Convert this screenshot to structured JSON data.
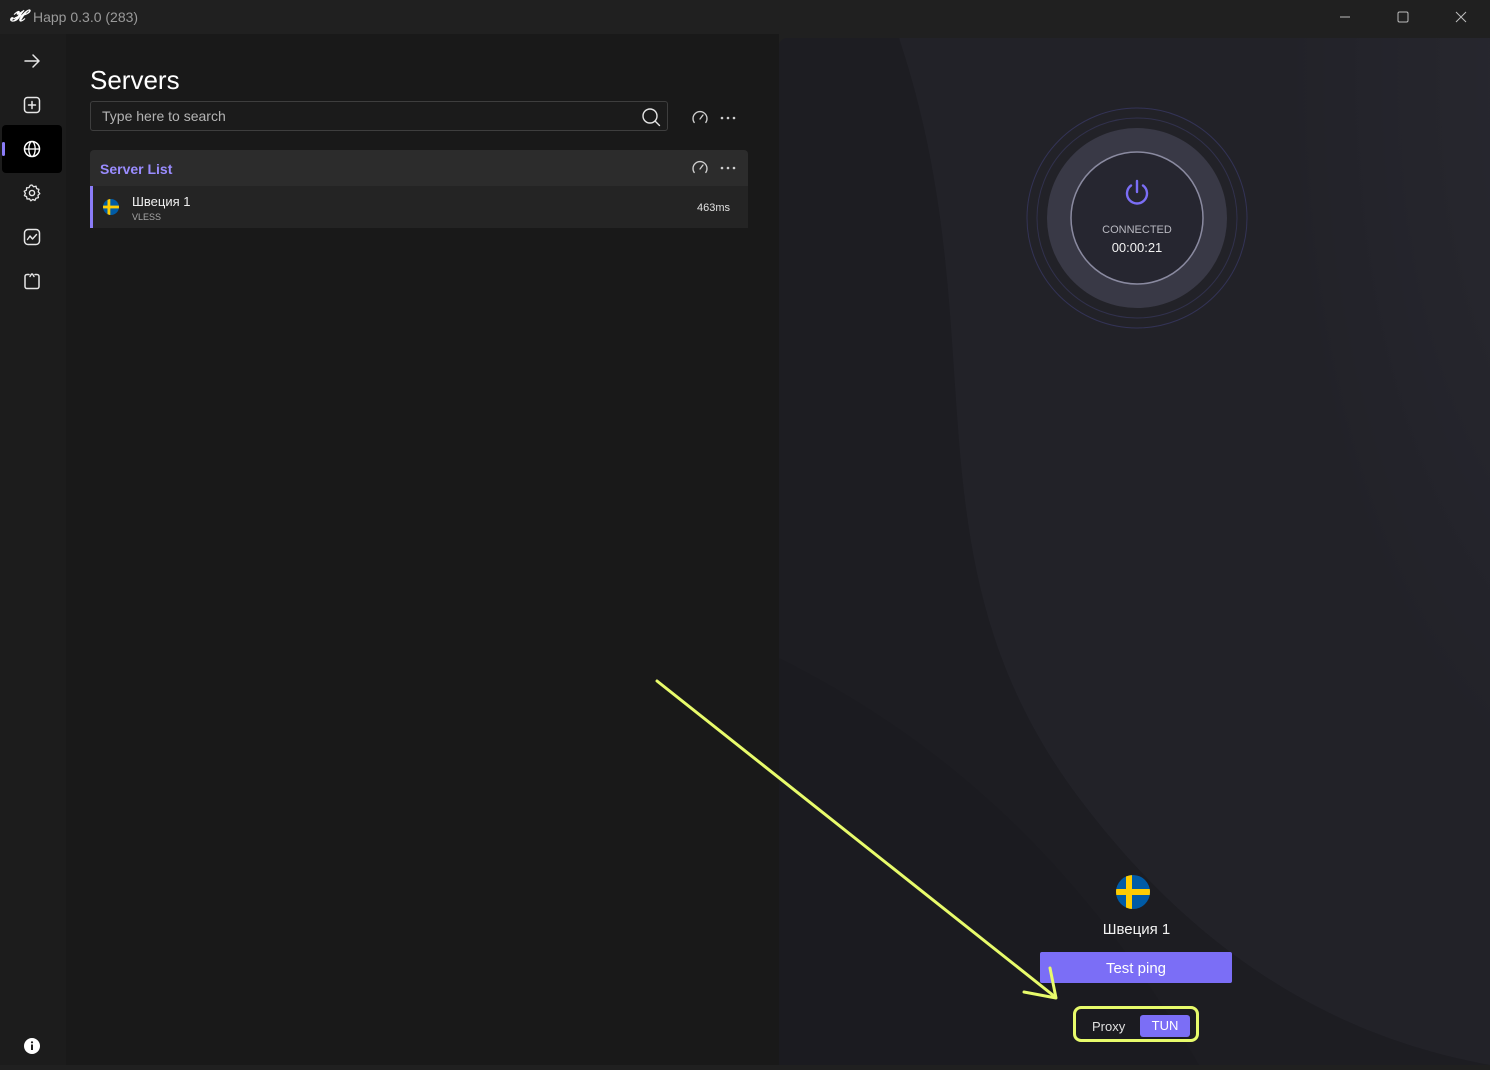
{
  "window": {
    "title": "Happ 0.3.0 (283)",
    "logo_icon": "happ-logo-icon",
    "controls": [
      "minimize-icon",
      "maximize-icon",
      "close-icon"
    ]
  },
  "sidebar": {
    "items": [
      {
        "name": "collapse",
        "icon": "arrow-right-icon",
        "active": false
      },
      {
        "name": "add",
        "icon": "plus-square-icon",
        "active": false
      },
      {
        "name": "servers",
        "icon": "globe-icon",
        "active": true
      },
      {
        "name": "settings",
        "icon": "gear-icon",
        "active": false
      },
      {
        "name": "stats",
        "icon": "chart-square-icon",
        "active": false
      },
      {
        "name": "logs",
        "icon": "clipboard-icon",
        "active": false
      }
    ],
    "footer_icon": "info-icon"
  },
  "servers": {
    "title": "Servers",
    "search_placeholder": "Type here to search",
    "group": {
      "title": "Server List",
      "items": [
        {
          "flag": "sweden-flag-icon",
          "name": "Швеция 1",
          "protocol": "VLESS",
          "ping": "463ms",
          "selected": true
        }
      ]
    }
  },
  "connection": {
    "status": "CONNECTED",
    "timer": "00:00:21",
    "selected_server": "Швеция 1",
    "test_ping_label": "Test ping",
    "mode": {
      "proxy_label": "Proxy",
      "tun_label": "TUN",
      "active": "TUN"
    }
  },
  "colors": {
    "accent": "#7b6ef6",
    "accent_light": "#9a8cff",
    "highlight": "#e8fb6b",
    "panel_bg": "#191919",
    "sidebar_bg": "#1c1c1c"
  }
}
